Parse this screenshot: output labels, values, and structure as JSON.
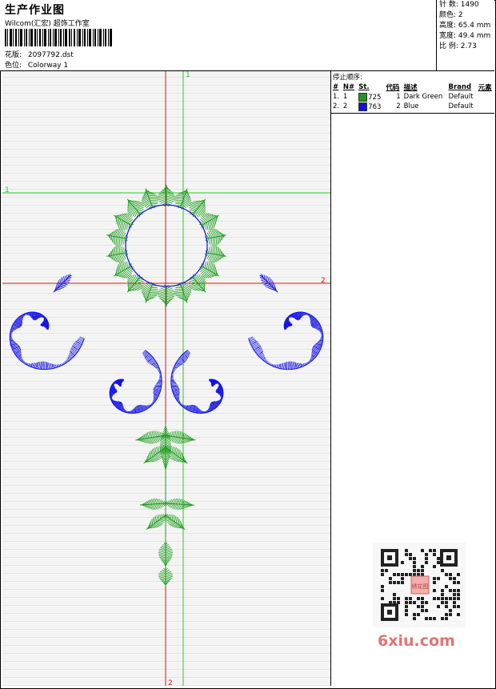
{
  "header": {
    "title": "生产作业图",
    "company": "Wilcom(汇宏) 超饰工作室",
    "design_label": "花版:",
    "design_value": "2097792.dst",
    "colorway_label": "色位:",
    "colorway_value": "Colorway 1"
  },
  "stats": {
    "stitches": "针 数: 1490",
    "colors": "颜色: 2",
    "height": "高度: 65.4 mm",
    "width": "宽度: 49.4 mm",
    "ratio": "比 例: 2.73"
  },
  "stop_sequence": {
    "title": "停止顺序:",
    "columns": [
      "#",
      "N#",
      "St.",
      "代码",
      "描述",
      "Brand",
      "元素"
    ],
    "rows": [
      {
        "idx": "1.",
        "n": "1",
        "st": "725",
        "code": "1",
        "desc": "Dark Green",
        "brand": "Default",
        "color": "#1a9b1a"
      },
      {
        "idx": "2.",
        "n": "2",
        "st": "763",
        "code": "2",
        "desc": "Blue",
        "brand": "Default",
        "color": "#1010e8"
      }
    ]
  },
  "axes": {
    "green_v": "1",
    "green_h": "1",
    "red_h": "2",
    "red_v": "2"
  },
  "watermark": {
    "site": "6xiu.com",
    "stamp": "绣花图"
  },
  "colors": {
    "green_thread": "#1a9b1a",
    "blue_thread": "#1010e8",
    "red_axis": "#e01010",
    "green_axis": "#22cc22"
  }
}
